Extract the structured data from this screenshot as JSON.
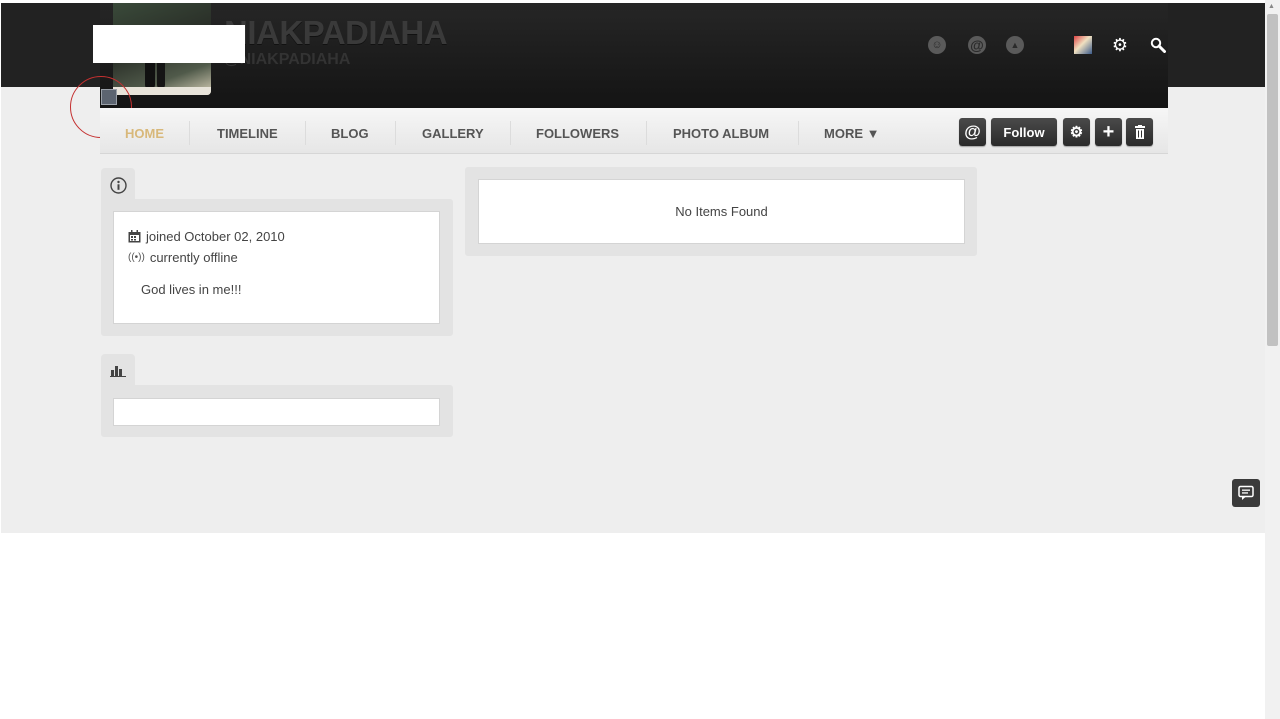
{
  "header": {
    "name": "NIAKPADIAHA",
    "handle": "@NIAKPADIAHA"
  },
  "nav": {
    "items": [
      {
        "label": "HOME",
        "active": true
      },
      {
        "label": "TIMELINE"
      },
      {
        "label": "BLOG"
      },
      {
        "label": "GALLERY"
      },
      {
        "label": "FOLLOWERS"
      },
      {
        "label": "PHOTO ALBUM"
      },
      {
        "label": "MORE ▼"
      }
    ],
    "follow_label": "Follow"
  },
  "info_widget": {
    "joined": "joined October 02, 2010",
    "status": "currently offline",
    "bio": "God lives in me!!!"
  },
  "timeline": {
    "empty_message": "No Items Found"
  },
  "colors": {
    "active_nav": "#d8b87a",
    "header_bg": "#1c1c1c",
    "page_bg": "#eeeeee",
    "annotation_circle": "#c43030"
  },
  "icons": {
    "header": [
      "friends-icon",
      "mentions-icon",
      "notifications-icon",
      "user-avatar",
      "settings-gear-icon",
      "search-icon"
    ],
    "actions": [
      "mention-icon",
      "settings-gear-icon",
      "add-icon",
      "trash-icon"
    ],
    "widgets": [
      "info-icon",
      "stats-icon"
    ],
    "floating": [
      "chat-icon"
    ]
  }
}
